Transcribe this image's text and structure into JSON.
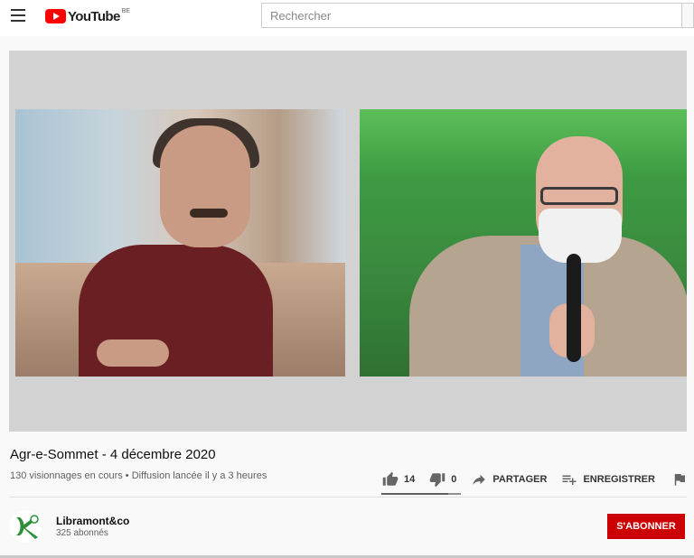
{
  "header": {
    "logo_text": "YouTube",
    "region": "BE",
    "search_placeholder": "Rechercher"
  },
  "video": {
    "title": "Agr-e-Sommet - 4 décembre 2020",
    "view_info": "130 visionnages en cours • Diffusion lancée il y a 3 heures",
    "likes": "14",
    "dislikes": "0",
    "share_label": "PARTAGER",
    "save_label": "ENREGISTRER"
  },
  "channel": {
    "name": "Libramont&co",
    "subscribers": "325 abonnés",
    "subscribe_label": "S'ABONNER"
  },
  "colors": {
    "brand": "#ff0000",
    "subscribe": "#cc0000",
    "avatar_green": "#2d8f3c"
  }
}
